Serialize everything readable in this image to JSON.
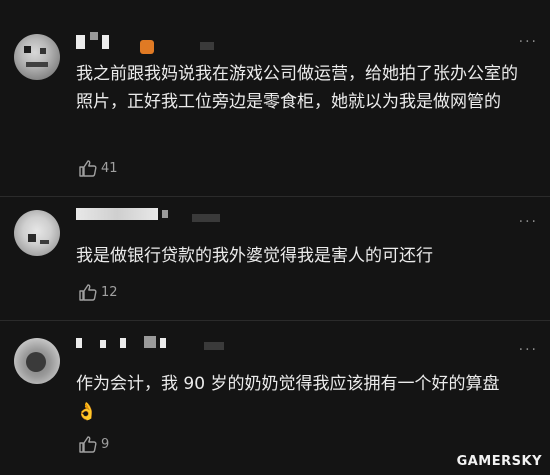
{
  "comments": [
    {
      "text": "我之前跟我妈说我在游戏公司做运营，给她拍了张办公室的照片，正好我工位旁边是零食柜，她就以为我是做网管的",
      "likes": "41"
    },
    {
      "text": "我是做银行贷款的我外婆觉得我是害人的可还行",
      "likes": "12"
    },
    {
      "text": "作为会计，我 90 岁的奶奶觉得我应该拥有一个好的算盘👌",
      "likes": "9"
    }
  ],
  "more_label": "···",
  "watermark": "GAMERSKY",
  "colors": {
    "background": "#141414",
    "text": "#ebebeb",
    "meta": "#a0a0a0",
    "badge": "#e07a24"
  }
}
